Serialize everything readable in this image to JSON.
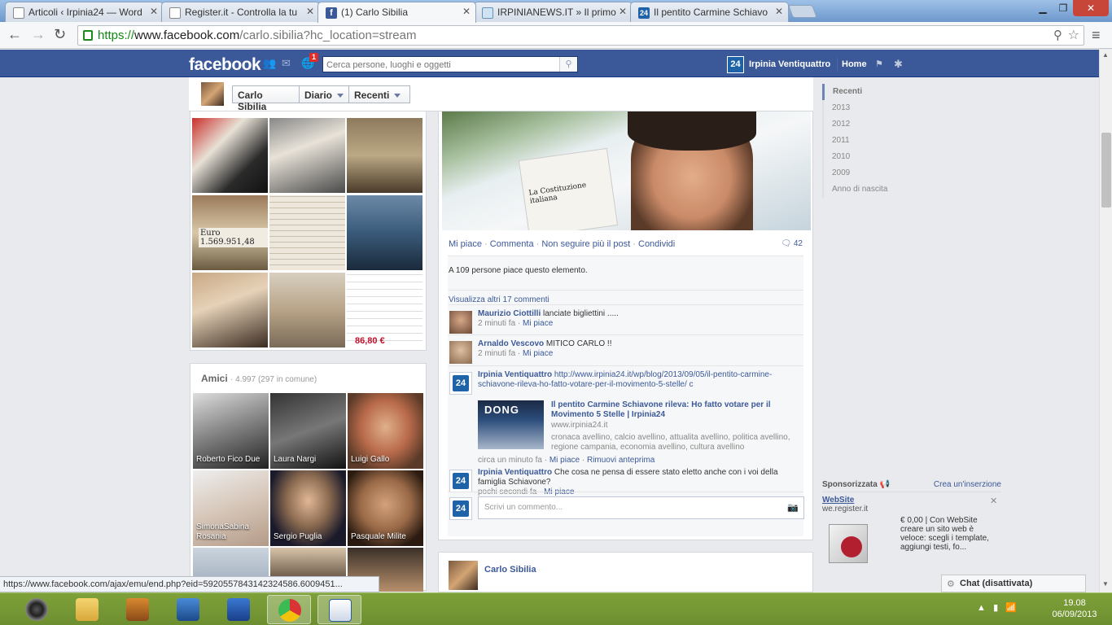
{
  "browser": {
    "tabs": [
      {
        "label": "Articoli ‹ Irpinia24 — Word",
        "icon": "document-icon"
      },
      {
        "label": "Register.it - Controlla la tu",
        "icon": "document-icon"
      },
      {
        "label": "(1) Carlo Sibilia",
        "icon": "facebook-icon",
        "active": true
      },
      {
        "label": "IRPINIANEWS.IT » Il primo",
        "icon": "irpinianews-icon"
      },
      {
        "label": "Il pentito Carmine Schiavo",
        "icon": "irpinia24-icon"
      }
    ],
    "url_scheme": "https://",
    "url_host": "www.facebook.com",
    "url_path": "/carlo.sibilia?hc_location=stream",
    "status_url": "https://www.facebook.com/ajax/emu/end.php?eid=5920557843142324586.6009451..."
  },
  "fb": {
    "logo": "facebook",
    "notif_count": "1",
    "search_placeholder": "Cerca persone, luoghi e oggetti",
    "page_badge": "24",
    "page_name": "Irpinia Ventiquattro",
    "home": "Home"
  },
  "profile": {
    "name": "Carlo Sibilia",
    "diary": "Diario",
    "recent": "Recenti"
  },
  "photos": {
    "overlay_text_1": "Euro 1.569.951,48",
    "overlay_text_2": "86,80 €"
  },
  "friends": {
    "title": "Amici",
    "count": "· 4.997 (297 in comune)",
    "items": [
      {
        "name": "Roberto Fico Due"
      },
      {
        "name": "Laura Nargi"
      },
      {
        "name": "Luigi Gallo"
      },
      {
        "name": "SimonaSabina Rosania"
      },
      {
        "name": "Sergio Puglia"
      },
      {
        "name": "Pasquale Milite"
      }
    ]
  },
  "post": {
    "image_caption": "La Costituzione italiana",
    "actions": {
      "like": "Mi piace",
      "comment": "Commenta",
      "unfollow": "Non seguire più il post",
      "share": "Condividi",
      "comments_count": "42"
    },
    "likes_summary": "A 109 persone piace questo elemento.",
    "more_comments": "Visualizza altri 17 commenti",
    "comments": [
      {
        "author": "Maurizio Ciottilli",
        "text": "lanciate bigliettini .....",
        "time": "2 minuti fa",
        "like": "Mi piace"
      },
      {
        "author": "Arnaldo Vescovo",
        "text": "MITICO CARLO !!",
        "time": "2 minuti fa",
        "like": "Mi piace"
      },
      {
        "author": "Irpinia Ventiquattro",
        "text": "http://www.irpinia24.it/wp/blog/2013/09/05/il-pentito-carmine-schiavone-rileva-ho-fatto-votare-per-il-movimento-5-stelle/ c",
        "time": "circa un minuto fa",
        "like": "Mi piace",
        "remove": "Rimuovi anteprima"
      },
      {
        "author": "Irpinia Ventiquattro",
        "text": "Che cosa ne pensa di essere stato eletto anche con i voi della famiglia Schiavone?",
        "time": "pochi secondi fa",
        "like": "Mi piace"
      }
    ],
    "link_preview": {
      "title": "Il pentito Carmine Schiavone rileva: Ho fatto votare per il Movimento 5 Stelle | Irpinia24",
      "url": "www.irpinia24.it",
      "description": "cronaca avellino, calcio avellino, attualita avellino, politica avellino, regione campania, economia avellino, cultura avellino",
      "thumb_text": "DONG"
    },
    "write_placeholder": "Scrivi un commento..."
  },
  "post2": {
    "author": "Carlo Sibilia"
  },
  "timeline": [
    "Recenti",
    "2013",
    "2012",
    "2011",
    "2010",
    "2009",
    "Anno di nascita"
  ],
  "sponsor": {
    "label": "Sponsorizzata",
    "create": "Crea un'inserzione",
    "title": "WebSite",
    "url": "we.register.it",
    "text": "€ 0,00 | Con WebSite creare un sito web è veloce: scegli i template, aggiungi testi, fo..."
  },
  "chat": {
    "label": "Chat (disattivata)"
  },
  "taskbar": {
    "time": "19.08",
    "date": "06/09/2013"
  },
  "colors": {
    "fb_blue": "#3b5998",
    "taskbar_green": "#7fa13a"
  }
}
